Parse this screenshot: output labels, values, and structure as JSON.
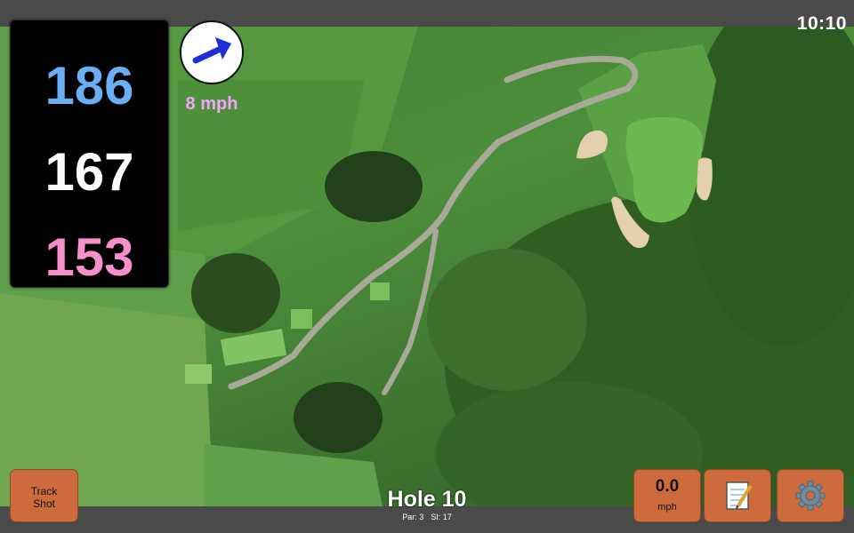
{
  "status": {
    "clock": "10:10"
  },
  "yardages": {
    "back": "186",
    "middle": "167",
    "front": "153"
  },
  "wind": {
    "speed_label": "8 mph",
    "direction_icon": "wind-arrow-icon"
  },
  "hole": {
    "title": "Hole 10",
    "par": "Par: 3",
    "stroke_index": "SI: 17"
  },
  "buttons": {
    "track_shot": [
      "Track",
      "Shot"
    ],
    "speed": {
      "value": "0.0",
      "unit": "mph"
    },
    "notes_icon": "notepad-icon",
    "settings_icon": "gear-icon"
  },
  "colors": {
    "back_yardage": "#6aaef4",
    "middle_yardage": "#ffffff",
    "front_yardage": "#f78fcb",
    "wind_label": "#f3a4ff",
    "button_fill": "#cd6b3d"
  }
}
